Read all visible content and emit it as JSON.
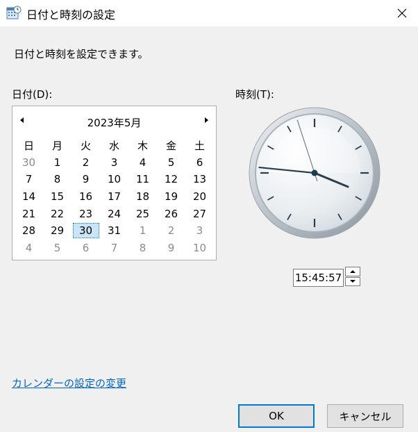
{
  "window": {
    "title": "日付と時刻の設定",
    "icon": "calendar-clock-icon",
    "close_icon": "close-icon"
  },
  "description": "日付と時刻を設定できます。",
  "date_label": "日付(D):",
  "time_label": "時刻(T):",
  "calendar": {
    "month_label": "2023年5月",
    "weekdays": [
      "日",
      "月",
      "火",
      "水",
      "木",
      "金",
      "土"
    ],
    "weeks": [
      [
        {
          "d": "30",
          "other": true
        },
        {
          "d": "1"
        },
        {
          "d": "2"
        },
        {
          "d": "3"
        },
        {
          "d": "4"
        },
        {
          "d": "5"
        },
        {
          "d": "6"
        }
      ],
      [
        {
          "d": "7"
        },
        {
          "d": "8"
        },
        {
          "d": "9"
        },
        {
          "d": "10"
        },
        {
          "d": "11"
        },
        {
          "d": "12"
        },
        {
          "d": "13"
        }
      ],
      [
        {
          "d": "14"
        },
        {
          "d": "15"
        },
        {
          "d": "16"
        },
        {
          "d": "17"
        },
        {
          "d": "18"
        },
        {
          "d": "19"
        },
        {
          "d": "20"
        }
      ],
      [
        {
          "d": "21"
        },
        {
          "d": "22"
        },
        {
          "d": "23"
        },
        {
          "d": "24"
        },
        {
          "d": "25"
        },
        {
          "d": "26"
        },
        {
          "d": "27"
        }
      ],
      [
        {
          "d": "28"
        },
        {
          "d": "29"
        },
        {
          "d": "30",
          "selected": true
        },
        {
          "d": "31"
        },
        {
          "d": "1",
          "other": true
        },
        {
          "d": "2",
          "other": true
        },
        {
          "d": "3",
          "other": true
        }
      ],
      [
        {
          "d": "4",
          "other": true
        },
        {
          "d": "5",
          "other": true
        },
        {
          "d": "6",
          "other": true
        },
        {
          "d": "7",
          "other": true
        },
        {
          "d": "8",
          "other": true
        },
        {
          "d": "9",
          "other": true
        },
        {
          "d": "10",
          "other": true
        }
      ]
    ]
  },
  "clock": {
    "hours": 15,
    "minutes": 45,
    "seconds": 57
  },
  "time_value": "15:45:57",
  "calendar_link": "カレンダーの設定の変更",
  "buttons": {
    "ok": "OK",
    "cancel": "キャンセル"
  },
  "colors": {
    "accent": "#0078d7",
    "link": "#0066cc",
    "selected_bg": "#cce4f7"
  }
}
